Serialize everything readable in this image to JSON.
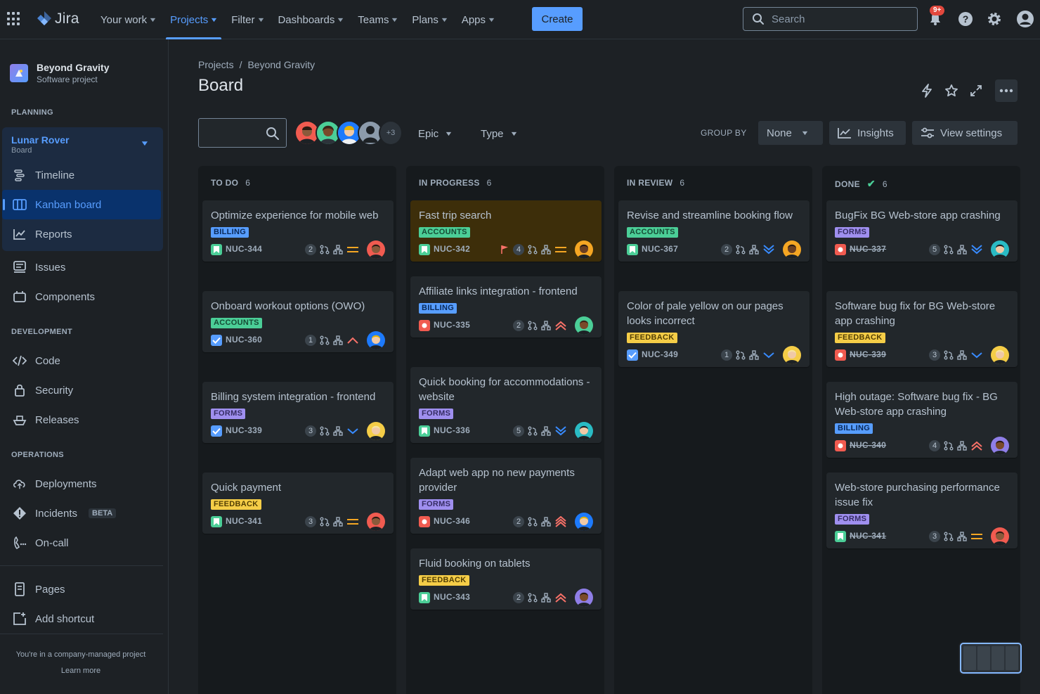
{
  "topnav": {
    "logo_text": "Jira",
    "items": [
      {
        "label": "Your work"
      },
      {
        "label": "Projects",
        "active": true
      },
      {
        "label": "Filter"
      },
      {
        "label": "Dashboards"
      },
      {
        "label": "Teams"
      },
      {
        "label": "Plans"
      },
      {
        "label": "Apps"
      }
    ],
    "create_label": "Create",
    "search_placeholder": "Search",
    "notification_badge": "9+"
  },
  "sidebar": {
    "project_name": "Beyond Gravity",
    "project_type": "Software project",
    "planning_heading": "PLANNING",
    "board_name": "Lunar Rover",
    "board_type": "Board",
    "planning_items": [
      "Timeline",
      "Kanban board",
      "Reports"
    ],
    "misc_items": [
      "Issues",
      "Components"
    ],
    "development_heading": "DEVELOPMENT",
    "development_items": [
      "Code",
      "Security",
      "Releases"
    ],
    "operations_heading": "OPERATIONS",
    "operations_items": [
      "Deployments",
      "Incidents",
      "On-call"
    ],
    "incidents_badge": "BETA",
    "bottom_items": [
      "Pages",
      "Add shortcut"
    ],
    "footer_text": "You're in a company-managed project",
    "learn_more": "Learn more"
  },
  "header": {
    "breadcrumb": [
      "Projects",
      "Beyond Gravity"
    ],
    "breadcrumb_sep": "/",
    "title": "Board"
  },
  "toolbar": {
    "avatars_more": "+3",
    "epic_label": "Epic",
    "type_label": "Type",
    "group_by_label": "GROUP BY",
    "group_by_value": "None",
    "insights_label": "Insights",
    "view_settings_label": "View settings"
  },
  "colors": {
    "accent": "#579dff",
    "billing": "#579dff",
    "accounts": "#4bce97",
    "forms": "#9f8fef",
    "feedback": "#f5cd47",
    "bug": "#f15b50"
  },
  "columns": [
    {
      "name": "TO DO",
      "count": "6",
      "done": false,
      "cards": [
        {
          "title": "Optimize experience for mobile web",
          "label": "BILLING",
          "type": "story",
          "key": "NUC-344",
          "estimate": "2",
          "priority": "medium",
          "avatar": 0
        },
        {
          "title": "Onboard workout options (OWO)",
          "label": "ACCOUNTS",
          "type": "task",
          "key": "NUC-360",
          "estimate": "1",
          "priority": "high",
          "avatar": 2
        },
        {
          "title": "Billing system integration - frontend",
          "label": "FORMS",
          "type": "task",
          "key": "NUC-339",
          "estimate": "3",
          "priority": "low",
          "avatar": 3
        },
        {
          "title": "Quick payment",
          "label": "FEEDBACK",
          "type": "story",
          "key": "NUC-341",
          "estimate": "3",
          "priority": "medium",
          "avatar": 0
        }
      ]
    },
    {
      "name": "IN PROGRESS",
      "count": "6",
      "done": false,
      "cards": [
        {
          "title": "Fast trip search",
          "label": "ACCOUNTS",
          "type": "story",
          "key": "NUC-342",
          "estimate": "4",
          "priority": "medium",
          "avatar": 4,
          "flagged": true
        },
        {
          "title": "Affiliate links integration - frontend",
          "label": "BILLING",
          "type": "bug",
          "key": "NUC-335",
          "estimate": "2",
          "priority": "highest",
          "avatar": 1
        },
        {
          "title": "Quick booking for accommodations - website",
          "label": "FORMS",
          "type": "story",
          "key": "NUC-336",
          "estimate": "5",
          "priority": "lowest",
          "avatar": 5
        },
        {
          "title": "Adapt web app no new payments provider",
          "label": "FORMS",
          "type": "bug",
          "key": "NUC-346",
          "estimate": "2",
          "priority": "critical",
          "avatar": 2
        },
        {
          "title": "Fluid booking on tablets",
          "label": "FEEDBACK",
          "type": "story",
          "key": "NUC-343",
          "estimate": "2",
          "priority": "highest",
          "avatar": 6
        }
      ]
    },
    {
      "name": "IN REVIEW",
      "count": "6",
      "done": false,
      "cards": [
        {
          "title": "Revise and streamline booking flow",
          "label": "ACCOUNTS",
          "type": "story",
          "key": "NUC-367",
          "estimate": "2",
          "priority": "lowest",
          "avatar": 4
        },
        {
          "title": "Color of pale yellow on our pages looks incorrect",
          "label": "FEEDBACK",
          "type": "task",
          "key": "NUC-349",
          "estimate": "1",
          "priority": "low",
          "avatar": 3
        }
      ]
    },
    {
      "name": "DONE",
      "count": "6",
      "done": true,
      "cards": [
        {
          "title": "BugFix BG Web-store app crashing",
          "label": "FORMS",
          "type": "bug",
          "key": "NUC-337",
          "estimate": "5",
          "priority": "lowest",
          "avatar": 5,
          "strike": true
        },
        {
          "title": "Software bug fix for BG Web-store app crashing",
          "label": "FEEDBACK",
          "type": "bug",
          "key": "NUC-339",
          "estimate": "3",
          "priority": "low",
          "avatar": 3,
          "strike": true
        },
        {
          "title": "High outage: Software bug fix - BG Web-store app crashing",
          "label": "BILLING",
          "type": "bug",
          "key": "NUC-340",
          "estimate": "4",
          "priority": "highest",
          "avatar": 6,
          "strike": true
        },
        {
          "title": "Web-store purchasing performance issue fix",
          "label": "FORMS",
          "type": "story",
          "key": "NUC-341",
          "estimate": "3",
          "priority": "medium",
          "avatar": 0,
          "strike": true
        }
      ]
    }
  ]
}
